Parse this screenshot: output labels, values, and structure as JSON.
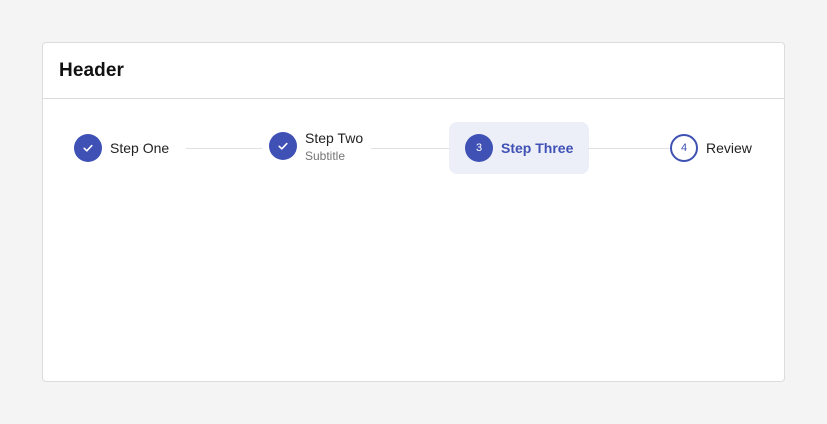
{
  "header": {
    "title": "Header"
  },
  "steps": [
    {
      "label": "Step One",
      "subtitle": "",
      "state": "completed",
      "icon": "check-icon"
    },
    {
      "label": "Step Two",
      "subtitle": "Subtitle",
      "state": "completed",
      "icon": "check-icon"
    },
    {
      "label": "Step Three",
      "subtitle": "",
      "state": "active",
      "number": "3"
    },
    {
      "label": "Review",
      "subtitle": "",
      "state": "upcoming",
      "number": "4"
    }
  ],
  "colors": {
    "primary": "#3f51b5",
    "active_bg": "#eceef8",
    "connector": "#e0e0e0",
    "page_bg": "#f4f4f4"
  }
}
